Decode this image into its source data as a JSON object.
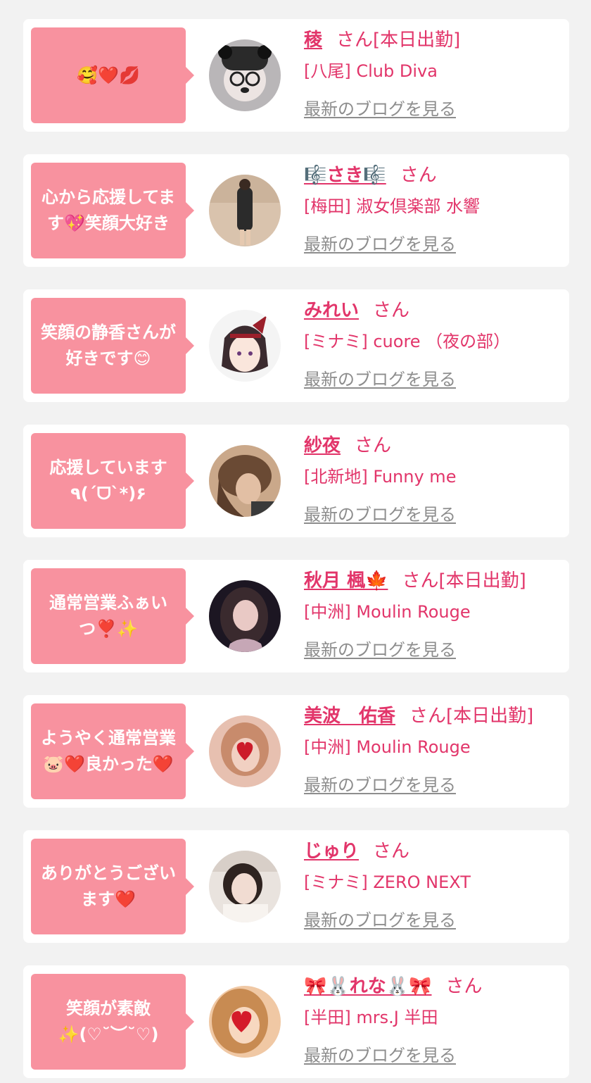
{
  "colors": {
    "page_background": "#f2f2f2",
    "card_background": "#ffffff",
    "bubble_pink": "#f8929f",
    "accent_pink": "#e2356a",
    "link_gray": "#8d8d8d"
  },
  "entries": [
    {
      "message": "🥰❤️💋",
      "avatar_icon": "avatar-photo-icon",
      "name": "稜",
      "honorific": "さん[本日出勤]",
      "store": "[八尾] Club Diva",
      "blog_link": "最新のブログを見る"
    },
    {
      "message": "心から応援してます💖笑顔大好き",
      "avatar_icon": "avatar-photo-icon",
      "name": "🎼さき🎼",
      "honorific": "さん",
      "store": "[梅田] 淑女倶楽部 水響",
      "blog_link": "最新のブログを見る"
    },
    {
      "message": "笑顔の静香さんが好きです😊",
      "avatar_icon": "avatar-illustration-icon",
      "name": "みれい",
      "honorific": "さん",
      "store": "[ミナミ] cuore （夜の部）",
      "blog_link": "最新のブログを見る"
    },
    {
      "message": "応援しています\n٩(´ᗜ`*)۶",
      "avatar_icon": "avatar-photo-icon",
      "name": "紗夜",
      "honorific": "さん",
      "store": "[北新地] Funny me",
      "blog_link": "最新のブログを見る"
    },
    {
      "message": "通常営業ふぁいつ❣️✨",
      "avatar_icon": "avatar-photo-icon",
      "name": "秋月 楓🍁",
      "honorific": "さん[本日出勤]",
      "store": "[中洲] Moulin Rouge",
      "blog_link": "最新のブログを見る"
    },
    {
      "message": "ようやく通常営業🐷❤️良かった❤️",
      "avatar_icon": "avatar-heart-photo-icon",
      "name": "美波　佑香",
      "honorific": "さん[本日出勤]",
      "store": "[中洲] Moulin Rouge",
      "blog_link": "最新のブログを見る"
    },
    {
      "message": "ありがとうございます❤️",
      "avatar_icon": "avatar-photo-icon",
      "name": "じゅり",
      "honorific": "さん",
      "store": "[ミナミ] ZERO NEXT",
      "blog_link": "最新のブログを見る"
    },
    {
      "message": "笑顔が素敵\n✨(♡˘︶˘♡)",
      "avatar_icon": "avatar-heart-photo-icon",
      "name": "🎀🐰れな🐰🎀",
      "honorific": "さん",
      "store": "[半田] mrs.J 半田",
      "blog_link": "最新のブログを見る"
    }
  ]
}
